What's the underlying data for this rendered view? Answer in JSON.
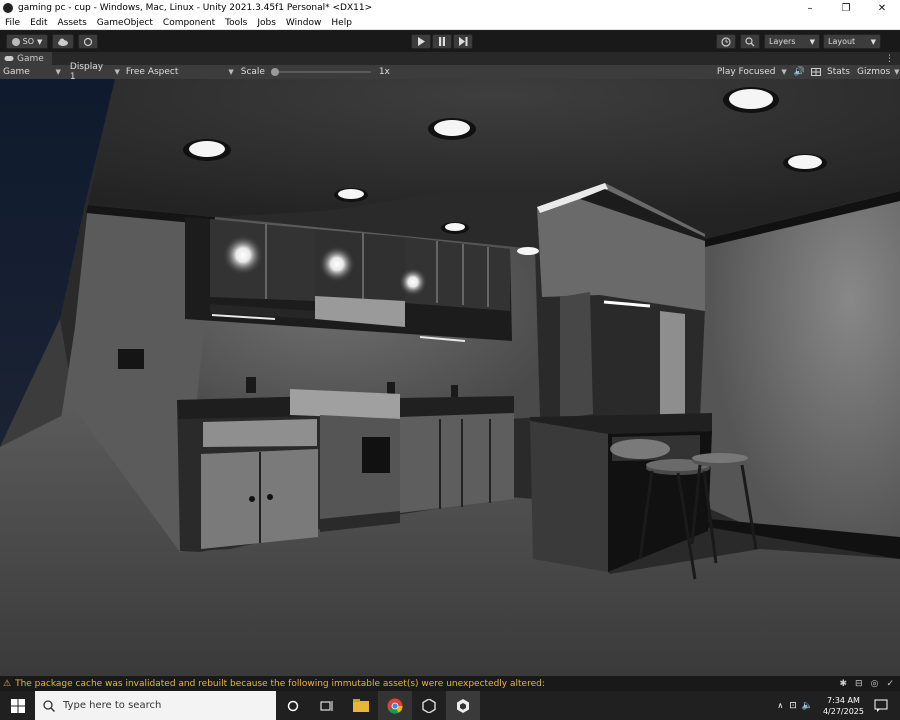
{
  "window": {
    "title": "gaming pc - cup - Windows, Mac, Linux - Unity 2021.3.45f1 Personal* <DX11>",
    "minimize": "–",
    "maximize": "❐",
    "close": "✕"
  },
  "menu": [
    "File",
    "Edit",
    "Assets",
    "GameObject",
    "Component",
    "Tools",
    "Jobs",
    "Window",
    "Help"
  ],
  "toolbar": {
    "account": "SO",
    "layers": "Layers",
    "layout": "Layout"
  },
  "tab": {
    "label": "Game"
  },
  "gamebar": {
    "view": "Game",
    "display": "Display 1",
    "aspect": "Free Aspect",
    "scale_label": "Scale",
    "scale_value": "1x",
    "play_focused": "Play Focused",
    "stats": "Stats",
    "gizmos": "Gizmos"
  },
  "status": {
    "message": "The package cache was invalidated and rebuilt because the following immutable asset(s) were unexpectedly altered:"
  },
  "taskbar": {
    "search_placeholder": "Type here to search",
    "time": "7:34 AM",
    "date": "4/27/2025"
  },
  "colors": {
    "unity_dark": "#191919",
    "panel": "#3c3c3c",
    "warning": "#e8b73a",
    "taskbar": "#202020"
  }
}
